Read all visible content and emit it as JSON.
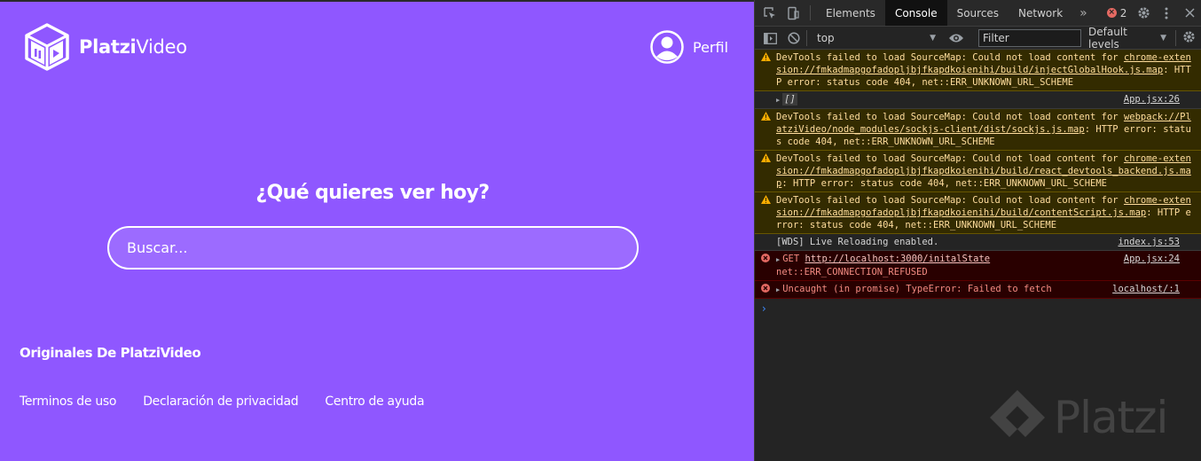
{
  "app": {
    "logo": {
      "bold": "Platzi",
      "light": "Video"
    },
    "profile_label": "Perfil",
    "hero_title": "¿Qué quieres ver hoy?",
    "search_placeholder": "Buscar...",
    "section_title": "Originales De PlatziVideo",
    "footer_links": [
      "Terminos de uso",
      "Declaración de privacidad",
      "Centro de ayuda"
    ],
    "accent_color": "#8f57ff"
  },
  "devtools": {
    "tabs": [
      "Elements",
      "Console",
      "Sources",
      "Network"
    ],
    "active_tab": "Console",
    "more_tabs_glyph": "»",
    "error_count": "2",
    "context": "top",
    "filter_placeholder": "Filter",
    "levels": "Default levels",
    "messages": [
      {
        "type": "warning",
        "pre": "DevTools failed to load SourceMap: Could not load content for ",
        "link": "chrome-extension://fmkadmapgofadopljbjfkapdkoienihi/build/injectGlobalHook.js.map",
        "post": ": HTTP error: status code 404, net::ERR_UNKNOWN_URL_SCHEME"
      },
      {
        "type": "log",
        "text": "[]",
        "source": "App.jsx:26"
      },
      {
        "type": "warning",
        "pre": "DevTools failed to load SourceMap: Could not load content for ",
        "link": "webpack://PlatziVideo/node_modules/sockjs-client/dist/sockjs.js.map",
        "post": ": HTTP error: status code 404, net::ERR_UNKNOWN_URL_SCHEME"
      },
      {
        "type": "warning",
        "pre": "DevTools failed to load SourceMap: Could not load content for ",
        "link": "chrome-extension://fmkadmapgofadopljbjfkapdkoienihi/build/react_devtools_backend.js.map",
        "post": ": HTTP error: status code 404, net::ERR_UNKNOWN_URL_SCHEME"
      },
      {
        "type": "warning",
        "pre": "DevTools failed to load SourceMap: Could not load content for ",
        "link": "chrome-extension://fmkadmapgofadopljbjfkapdkoienihi/build/contentScript.js.map",
        "post": ": HTTP error: status code 404, net::ERR_UNKNOWN_URL_SCHEME"
      },
      {
        "type": "info",
        "text": "[WDS] Live Reloading enabled.",
        "source": "index.js:53"
      },
      {
        "type": "error",
        "method": "GET",
        "url": "http://localhost:3000/initalState",
        "detail": "net::ERR_CONNECTION_REFUSED",
        "source": "App.jsx:24"
      },
      {
        "type": "error",
        "text": "Uncaught (in promise) TypeError: Failed to fetch",
        "source": "localhost/:1"
      }
    ],
    "prompt": "›"
  },
  "watermark": "Platzi"
}
